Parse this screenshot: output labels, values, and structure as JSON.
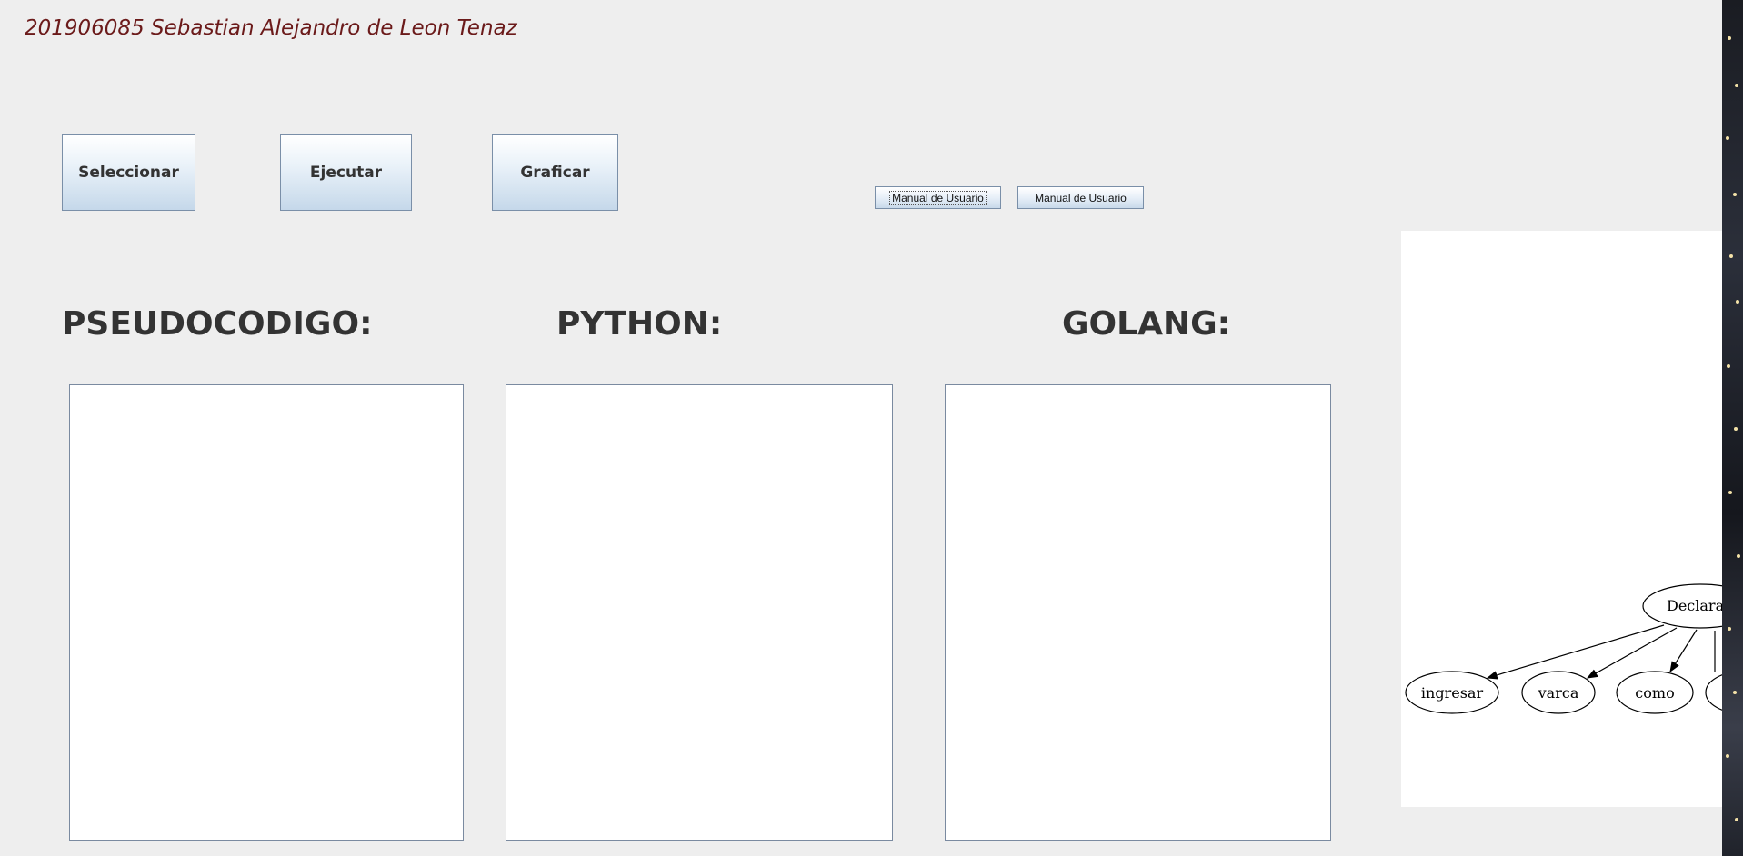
{
  "header": {
    "author": "201906085 Sebastian Alejandro de Leon Tenaz"
  },
  "toolbar": {
    "select_label": "Seleccionar",
    "execute_label": "Ejecutar",
    "graph_label": "Graficar",
    "manual_label_1": "Manual de Usuario",
    "manual_label_2": "Manual de Usuario"
  },
  "panels": {
    "pseudo_title": "PSEUDOCODIGO:",
    "python_title": "PYTHON:",
    "golang_title": "GOLANG:",
    "pseudo_content": "",
    "python_content": "",
    "golang_content": ""
  },
  "graph": {
    "root": "Declarac",
    "children": [
      "ingresar",
      "varca",
      "como"
    ]
  }
}
